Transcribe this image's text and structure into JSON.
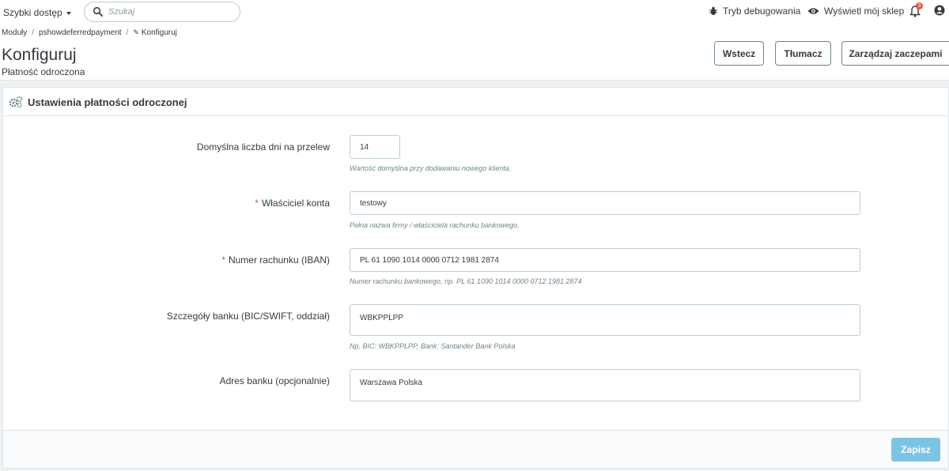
{
  "topbar": {
    "quick_access": "Szybki dostęp",
    "search_placeholder": "Szukaj",
    "debug_mode": "Tryb debugowania",
    "view_store": "Wyświetl mój sklep",
    "notifications_count": "3"
  },
  "breadcrumb": {
    "items": [
      "Moduły",
      "pshowdeferredpayment",
      "Konfiguruj"
    ]
  },
  "header": {
    "title": "Konfiguruj",
    "subtitle": "Płatność odroczona",
    "buttons": {
      "back": "Wstecz",
      "translate": "Tłumacz",
      "hooks": "Zarządzaj zaczepami"
    }
  },
  "panel": {
    "title": "Ustawienia płatności odroczonej",
    "fields": [
      {
        "label": "Domyślna liczba dni na przelew",
        "required": false,
        "value": "14",
        "help": "Wartość domyślna przy dodawaniu nowego klienta."
      },
      {
        "label": "Właściciel konta",
        "required": true,
        "value": "testowy",
        "help": "Pełna nazwa firmy / właściciela rachunku bankowego."
      },
      {
        "label": "Numer rachunku (IBAN)",
        "required": true,
        "value": "PL 61 1090 1014 0000 0712 1981 2874",
        "help": "Numer rachunku bankowego, np. PL 61 1090 1014 0000 0712 1981 2874"
      },
      {
        "label": "Szczegóły banku (BIC/SWIFT, oddział)",
        "required": false,
        "value": "WBKPPLPP",
        "help": "Np. BIC: WBKPPLPP, Bank: Santander Bank Polska"
      },
      {
        "label": "Adres banku (opcjonalnie)",
        "required": false,
        "value": "Warszawa Polska",
        "help": ""
      }
    ],
    "required_mark": "*",
    "save_label": "Zapisz"
  },
  "colors": {
    "accent": "#25b9d7",
    "save_button": "#7cc4e6",
    "required": "#c05c67",
    "notification_badge": "#f54c3e"
  }
}
